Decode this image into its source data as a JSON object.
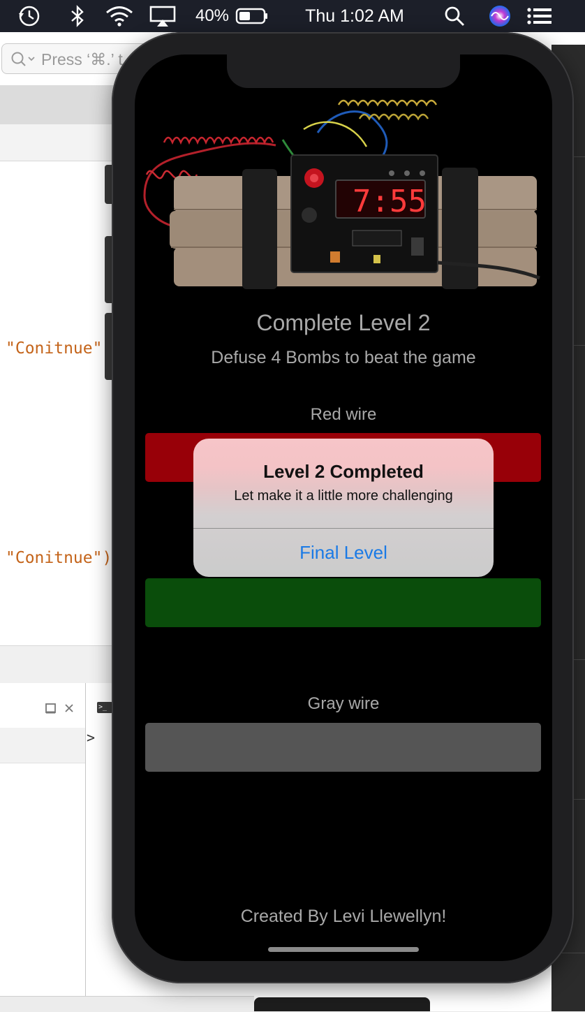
{
  "menubar": {
    "battery_percent": "40%",
    "clock": "Thu 1:02 AM",
    "icons": [
      "time-machine-icon",
      "bluetooth-icon",
      "wifi-icon",
      "airplay-icon",
      "battery-icon",
      "spotlight-search-icon",
      "siri-icon",
      "notification-center-icon"
    ]
  },
  "editor": {
    "search_placeholder": "Press ‘⌘.’ t",
    "code_line_1": "\"Conitnue\"",
    "code_line_2": "\"Conitnue\")",
    "console_prompt": ">"
  },
  "simulator": {
    "bomb_timer": "7:55",
    "level_title": "Complete Level 2",
    "level_subtitle": "Defuse 4 Bombs to beat the game",
    "red_wire_label": "Red wire",
    "gray_wire_label": "Gray wire",
    "credit": "Created By Levi Llewellyn!",
    "colors": {
      "red_wire": "#980008",
      "green_wire": "#0a4d0b",
      "gray_wire": "#555555",
      "alert_action": "#1a7ae6"
    }
  },
  "alert": {
    "title": "Level 2 Completed",
    "message": "Let make it a little more challenging",
    "action_label": "Final Level"
  }
}
